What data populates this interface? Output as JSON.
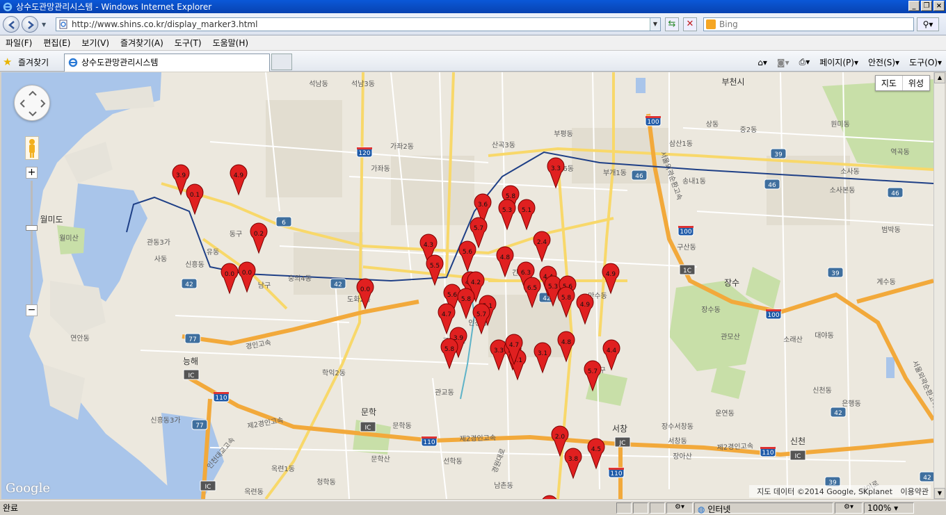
{
  "window": {
    "title": "상수도관망관리시스템 - Windows Internet Explorer"
  },
  "address": {
    "url": "http://www.shins.co.kr/display_marker3.html"
  },
  "search": {
    "placeholder": "Bing"
  },
  "menu": [
    "파일(F)",
    "편집(E)",
    "보기(V)",
    "즐겨찾기(A)",
    "도구(T)",
    "도움말(H)"
  ],
  "favorites": {
    "label": "즐겨찾기"
  },
  "tab": {
    "title": "상수도관망관리시스템"
  },
  "command_bar": {
    "page": "페이지(P)",
    "safety": "안전(S)",
    "tools": "도구(O)"
  },
  "map": {
    "type_buttons": [
      "지도",
      "위성"
    ],
    "attribution": {
      "data": "지도 데이터 ©2014 Google, SKplanet",
      "terms": "이용약관"
    },
    "google_logo": "Google",
    "place_labels": [
      {
        "t": "석남동"
      },
      {
        "t": "석남3동"
      },
      {
        "t": "가좌2동"
      },
      {
        "t": "가좌동"
      },
      {
        "t": "산곡3동"
      },
      {
        "t": "부평동"
      },
      {
        "t": "부평6동"
      },
      {
        "t": "부개1동"
      },
      {
        "t": "삼산1동"
      },
      {
        "t": "상동"
      },
      {
        "t": "중2동"
      },
      {
        "t": "원미동"
      },
      {
        "t": "부천시"
      },
      {
        "t": "역곡동"
      },
      {
        "t": "송내1동"
      },
      {
        "t": "소사동"
      },
      {
        "t": "소사본동"
      },
      {
        "t": "월미도"
      },
      {
        "t": "월미산"
      },
      {
        "t": "관동3가"
      },
      {
        "t": "사동"
      },
      {
        "t": "신흥동"
      },
      {
        "t": "유동"
      },
      {
        "t": "동구"
      },
      {
        "t": "남구"
      },
      {
        "t": "숭의4동"
      },
      {
        "t": "도화2동"
      },
      {
        "t": "간석동"
      },
      {
        "t": "만수동"
      },
      {
        "t": "인천광"
      },
      {
        "t": "구월3동"
      },
      {
        "t": "구월동"
      },
      {
        "t": "구산동"
      },
      {
        "t": "장수동"
      },
      {
        "t": "범박동"
      },
      {
        "t": "계수동"
      },
      {
        "t": "관모산"
      },
      {
        "t": "소래산"
      },
      {
        "t": "대야동"
      },
      {
        "t": "신천동"
      },
      {
        "t": "은행동"
      },
      {
        "t": "연안동"
      },
      {
        "t": "능해"
      },
      {
        "t": "학익2동"
      },
      {
        "t": "관교동"
      },
      {
        "t": "문학"
      },
      {
        "t": "문학동"
      },
      {
        "t": "문학산"
      },
      {
        "t": "신흥동3가"
      },
      {
        "t": "선학동"
      },
      {
        "t": "남동구"
      },
      {
        "t": "장수서창동"
      },
      {
        "t": "서창동"
      },
      {
        "t": "장아산"
      },
      {
        "t": "운연동"
      },
      {
        "t": "신천"
      },
      {
        "t": "옥련1동"
      },
      {
        "t": "청학동"
      },
      {
        "t": "옥련동"
      },
      {
        "t": "남촌동"
      },
      {
        "t": "서창"
      },
      {
        "t": "장수"
      },
      {
        "t": "경인고속"
      },
      {
        "t": "제2경인고속"
      },
      {
        "t": "제2경인고속"
      },
      {
        "t": "제2경인고속"
      },
      {
        "t": "인천대교고속"
      },
      {
        "t": "서울외곽순환고속"
      },
      {
        "t": "서울외곽순환고속"
      },
      {
        "t": "일이로"
      },
      {
        "t": "경원대로"
      }
    ],
    "route_shields": [
      "120",
      "100",
      "46",
      "46",
      "46",
      "39",
      "39",
      "39",
      "42",
      "42",
      "42",
      "42",
      "42",
      "6",
      "77",
      "77",
      "110",
      "110",
      "110",
      "110",
      "100",
      "100",
      "1C",
      "IC",
      "JC",
      "IC",
      "IC",
      "IC"
    ],
    "markers": [
      "3.3",
      "3.9",
      "4.9",
      "0.1",
      "0.2",
      "0.0",
      "0.0",
      "0.0",
      "3.6",
      "5.8",
      "5.3",
      "5.1",
      "5.7",
      "4.3",
      "5.6",
      "4.8",
      "2.4",
      "6.3",
      "4.4",
      "4.3",
      "4.2",
      "5.3",
      "6.5",
      "5.6",
      "5.8",
      "4.9",
      "5.6",
      "5.8",
      "5.1",
      "4.7",
      "5.7",
      "3.9",
      "5.8",
      "4.8",
      "3.1",
      "3.3",
      "3.3",
      "5.1",
      "4.7",
      "5.7",
      "4.4",
      "2.0",
      "4.5",
      "3.8",
      "3.4",
      "4.9",
      "5.5"
    ],
    "colors": {
      "marker": "#e02020",
      "expressway": "#f2a93b",
      "arterial": "#f8d86a",
      "water": "#a9c5ea",
      "park": "#c8dfa8",
      "rail": "#1e3f86"
    }
  },
  "status": {
    "done": "완료",
    "zone": "인터넷",
    "zoom": "100%"
  }
}
